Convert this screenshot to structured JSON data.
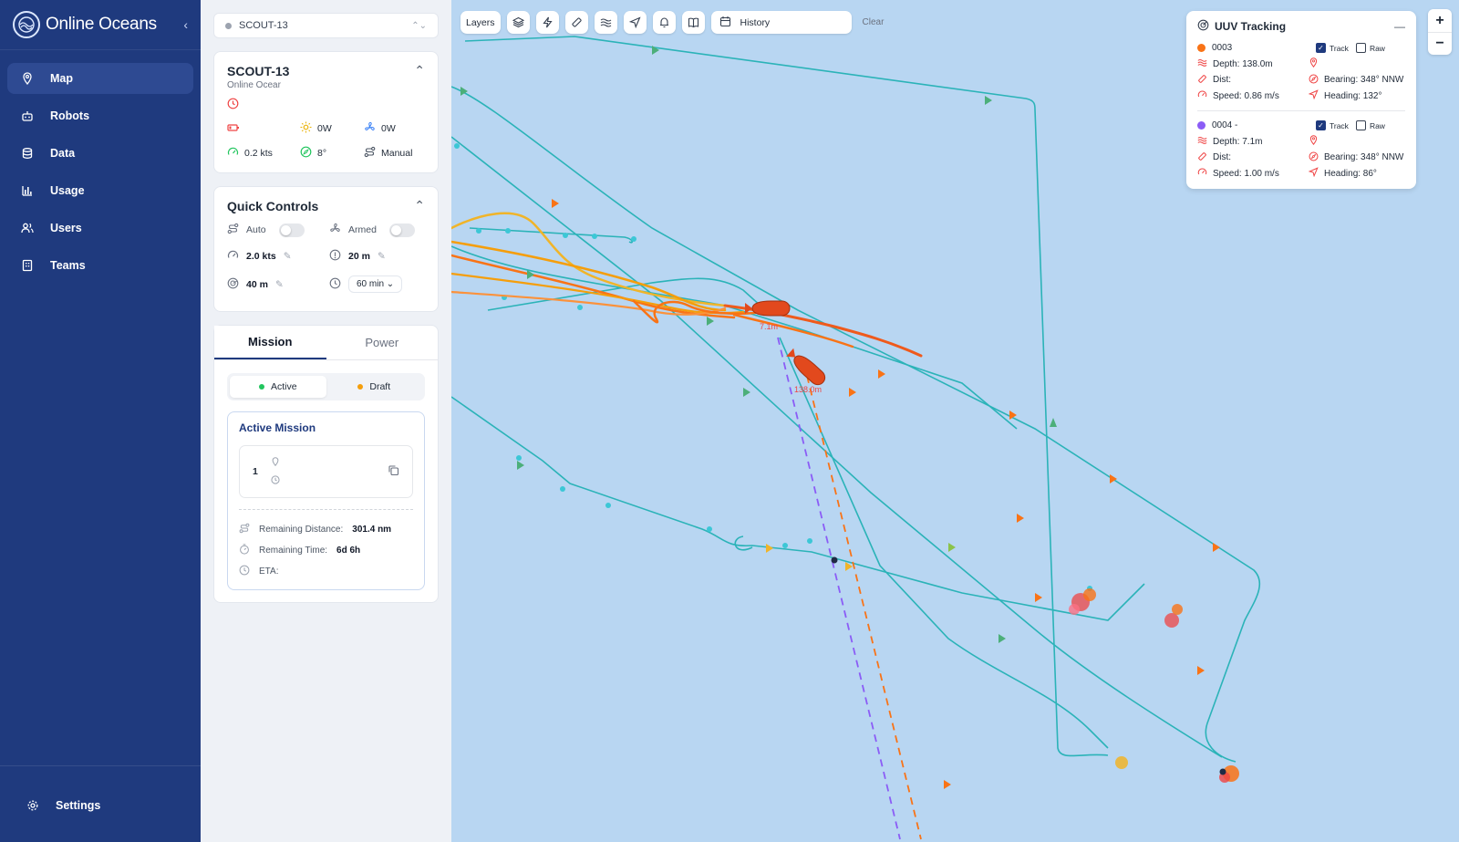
{
  "sidebar": {
    "brand": "Online Oceans",
    "items": [
      {
        "label": "Map",
        "icon": "map-pin-icon",
        "active": true
      },
      {
        "label": "Robots",
        "icon": "robot-icon"
      },
      {
        "label": "Data",
        "icon": "database-icon"
      },
      {
        "label": "Usage",
        "icon": "bar-chart-icon"
      },
      {
        "label": "Users",
        "icon": "users-icon"
      },
      {
        "label": "Teams",
        "icon": "building-icon"
      }
    ],
    "settings": "Settings"
  },
  "device_select": {
    "value": "SCOUT-13"
  },
  "robot": {
    "name": "SCOUT-13",
    "org": "Online Ocear",
    "solar": "0W",
    "power": "0W",
    "speed": "0.2 kts",
    "heading": "8°",
    "mode": "Manual"
  },
  "quick_controls": {
    "title": "Quick Controls",
    "auto_label": "Auto",
    "armed_label": "Armed",
    "speed": "2.0 kts",
    "depth": "20 m",
    "radius": "40 m",
    "interval": "60 min"
  },
  "mission": {
    "tabs": [
      "Mission",
      "Power"
    ],
    "segments": [
      "Active",
      "Draft"
    ],
    "active_title": "Active Mission",
    "waypoint_number": "1",
    "remaining_distance_label": "Remaining Distance:",
    "remaining_distance": "301.4 nm",
    "remaining_time_label": "Remaining Time:",
    "remaining_time": "6d 6h",
    "eta_label": "ETA:"
  },
  "toolbar": {
    "layers": "Layers",
    "history": "History",
    "clear": "Clear"
  },
  "tracking": {
    "title": "UUV Tracking",
    "minimize": "—",
    "track_label": "Track",
    "raw_label": "Raw",
    "vehicles": [
      {
        "id": "0003",
        "color": "#f97316",
        "depth": "Depth: 138.0m",
        "dist": "Dist:",
        "speed": "Speed: 0.86 m/s",
        "bearing": "Bearing: 348° NNW",
        "heading": "Heading: 132°"
      },
      {
        "id": "0004 -",
        "color": "#8b5cf6",
        "depth": "Depth: 7.1m",
        "dist": "Dist:",
        "speed": "Speed: 1.00 m/s",
        "bearing": "Bearing: 348° NNW",
        "heading": "Heading: 86°"
      }
    ]
  },
  "map": {
    "label_a": "7.1m",
    "label_b": "138.0m",
    "colors": {
      "teal": "#2bb3b8",
      "orange": "#f97316",
      "yellow": "#f0b429",
      "red": "#ef4444",
      "purple": "#8b5cf6"
    }
  },
  "zoom": {
    "in": "+",
    "out": "−"
  }
}
